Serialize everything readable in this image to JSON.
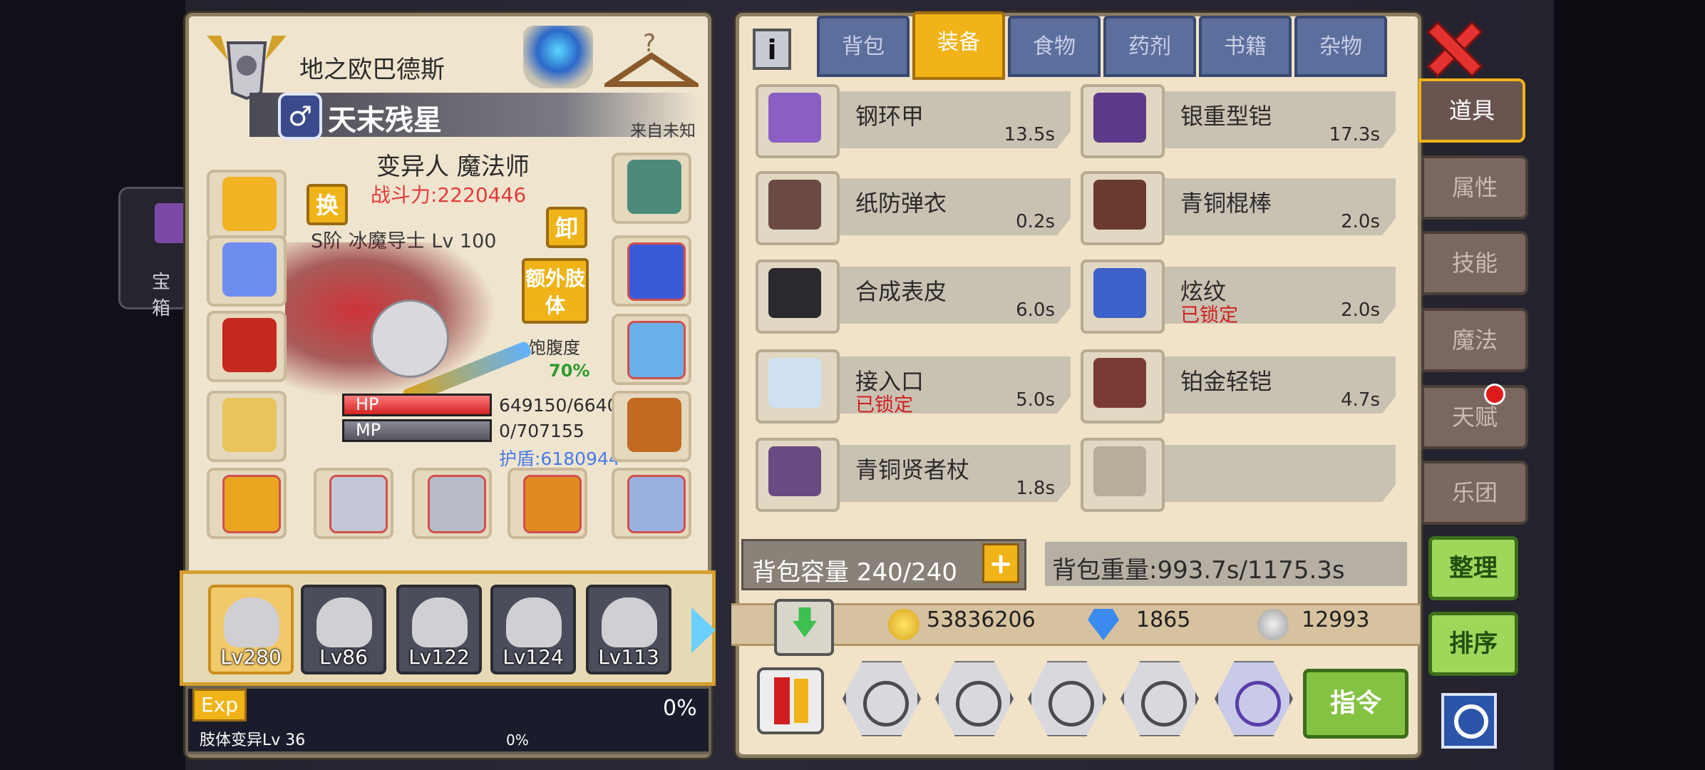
{
  "left_peek": {
    "label": "宝箱"
  },
  "character": {
    "location": "地之欧巴德斯",
    "title": "天末残星",
    "origin": "来自未知",
    "class_line": "变异人 魔法师",
    "power": "战斗力:2220446",
    "rank": "S阶 冰魔导士 Lv 100",
    "swap_label": "换",
    "unequip_label": "卸",
    "extra_limbs_label": "额外肢体",
    "satiety_label": "饱腹度",
    "satiety_value": "70%",
    "hp_label": "HP",
    "mp_label": "MP",
    "hp_value": "649150/6640",
    "mp_value": "0/707155",
    "shield": "护盾:6180944"
  },
  "party": [
    {
      "lv": "Lv280",
      "selected": true
    },
    {
      "lv": "Lv86"
    },
    {
      "lv": "Lv122"
    },
    {
      "lv": "Lv124"
    },
    {
      "lv": "Lv113"
    }
  ],
  "exp": {
    "label": "Exp",
    "percent": "0%",
    "limb_label": "肢体变异Lv 36",
    "limb_percent": "0%"
  },
  "tabs": [
    {
      "label": "背包"
    },
    {
      "label": "装备",
      "active": true
    },
    {
      "label": "食物"
    },
    {
      "label": "药剂"
    },
    {
      "label": "书籍"
    },
    {
      "label": "杂物"
    }
  ],
  "items": [
    {
      "name": "钢环甲",
      "time": "13.5s",
      "locked": "",
      "color": "#8a5ec2"
    },
    {
      "name": "银重型铠",
      "time": "17.3s",
      "locked": "",
      "color": "#5d3a8a"
    },
    {
      "name": "纸防弹衣",
      "time": "0.2s",
      "locked": "",
      "color": "#6b4a44"
    },
    {
      "name": "青铜棍棒",
      "time": "2.0s",
      "locked": "",
      "color": "#6a3a30"
    },
    {
      "name": "合成表皮",
      "time": "6.0s",
      "locked": "",
      "color": "#2a2a2e"
    },
    {
      "name": "炫纹",
      "time": "2.0s",
      "locked": "已锁定",
      "color": "#3d62c9"
    },
    {
      "name": "接入口",
      "time": "5.0s",
      "locked": "已锁定",
      "color": "#cfe0f2"
    },
    {
      "name": "铂金轻铠",
      "time": "4.7s",
      "locked": "",
      "color": "#7a3a34"
    },
    {
      "name": "青铜贤者杖",
      "time": "1.8s",
      "locked": "",
      "color": "#6a4a80"
    },
    {
      "name": "",
      "time": "",
      "locked": "",
      "color": "#b8ad9a"
    }
  ],
  "inventory": {
    "capacity": "背包容量 240/240",
    "add_label": "+",
    "weight": "背包重量:993.7s/1175.3s"
  },
  "currency": {
    "gold": "53836206",
    "diamonds": "1865",
    "silver": "12993"
  },
  "bottom": {
    "command_label": "指令"
  },
  "side_tabs": [
    {
      "label": "道具",
      "active": true
    },
    {
      "label": "属性"
    },
    {
      "label": "技能"
    },
    {
      "label": "魔法"
    },
    {
      "label": "天赋"
    },
    {
      "label": "乐团"
    }
  ],
  "actions": {
    "sort_label": "整理",
    "order_label": "排序"
  }
}
